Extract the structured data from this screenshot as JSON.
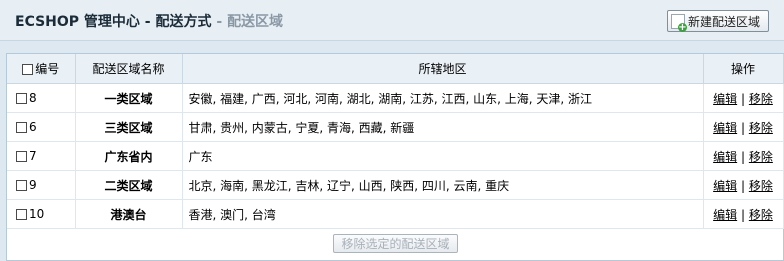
{
  "header": {
    "app": "ECSHOP 管理中心",
    "sep1": " - ",
    "section": "配送方式",
    "sep2": " - ",
    "page": "配送区域",
    "action_button": "新建配送区域"
  },
  "table": {
    "columns": [
      "编号",
      "配送区域名称",
      "所辖地区",
      "操作"
    ],
    "rows": [
      {
        "id": "8",
        "name": "一类区域",
        "regions": "安徽, 福建, 广西, 河北, 河南, 湖北, 湖南, 江苏, 江西, 山东, 上海, 天津, 浙江",
        "edit": "编辑",
        "sep": "|",
        "remove": "移除"
      },
      {
        "id": "6",
        "name": "三类区域",
        "regions": "甘肃, 贵州, 内蒙古, 宁夏, 青海, 西藏, 新疆",
        "edit": "编辑",
        "sep": "|",
        "remove": "移除"
      },
      {
        "id": "7",
        "name": "广东省内",
        "regions": "广东",
        "edit": "编辑",
        "sep": "|",
        "remove": "移除"
      },
      {
        "id": "9",
        "name": "二类区域",
        "regions": "北京, 海南, 黑龙江, 吉林, 辽宁, 山西, 陕西, 四川, 云南, 重庆",
        "edit": "编辑",
        "sep": "|",
        "remove": "移除"
      },
      {
        "id": "10",
        "name": "港澳台",
        "regions": "香港, 澳门, 台湾",
        "edit": "编辑",
        "sep": "|",
        "remove": "移除"
      }
    ]
  },
  "footer": {
    "remove_selected": "移除选定的配送区域"
  }
}
